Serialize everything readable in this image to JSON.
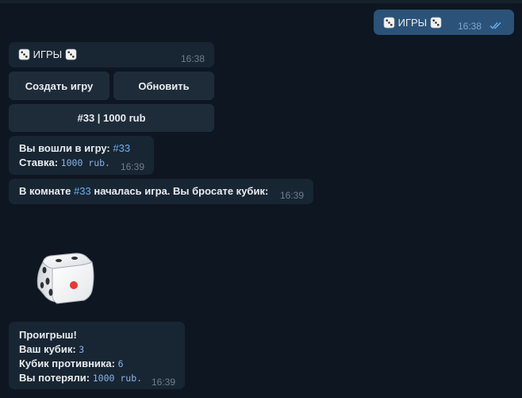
{
  "outgoing": {
    "text": "ИГРЫ",
    "time": "16:38"
  },
  "bot_menu": {
    "text": "ИГРЫ",
    "time": "16:38",
    "buttons": {
      "create": "Создать игру",
      "refresh": "Обновить",
      "game": "#33 | 1000 rub"
    }
  },
  "joined": {
    "line1_label": "Вы вошли в игру:",
    "game_id": "#33",
    "line2_label": "Ставка:",
    "bet": "1000 rub.",
    "time": "16:39"
  },
  "started": {
    "prefix": "В комнате",
    "room": "#33",
    "suffix": "началась игра. Вы бросате кубик:",
    "time": "16:39"
  },
  "dice": {
    "value": 3
  },
  "result": {
    "title": "Проигрыш!",
    "your_label": "Ваш кубик:",
    "your_value": "3",
    "opp_label": "Кубик противника:",
    "opp_value": "6",
    "lost_label": "Вы потеряли:",
    "lost_value": "1000 rub.",
    "time": "16:39"
  }
}
